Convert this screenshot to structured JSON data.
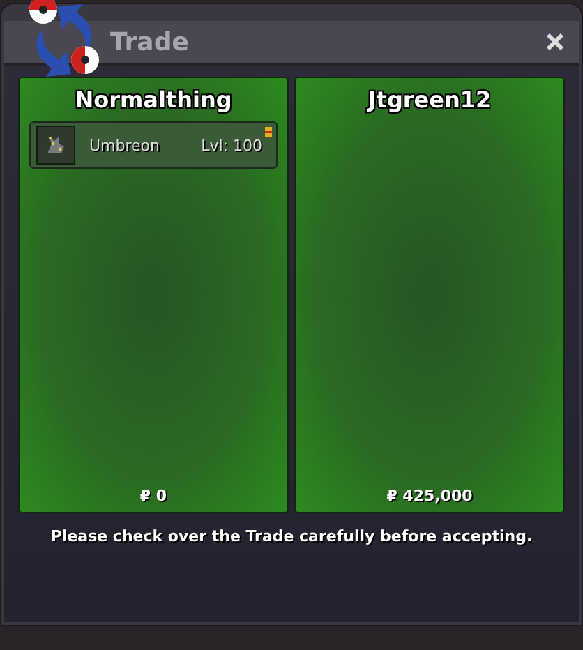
{
  "window": {
    "title": "Trade"
  },
  "sides": [
    {
      "trainer": "Normalthing",
      "pokemon": [
        {
          "name": "Umbreon",
          "level": "Lvl: 100",
          "held_item": true
        }
      ],
      "money": "₽ 0"
    },
    {
      "trainer": "Jtgreen12",
      "money": "₽ 425,000"
    }
  ],
  "message": "Please check over the Trade carefully before accepting."
}
